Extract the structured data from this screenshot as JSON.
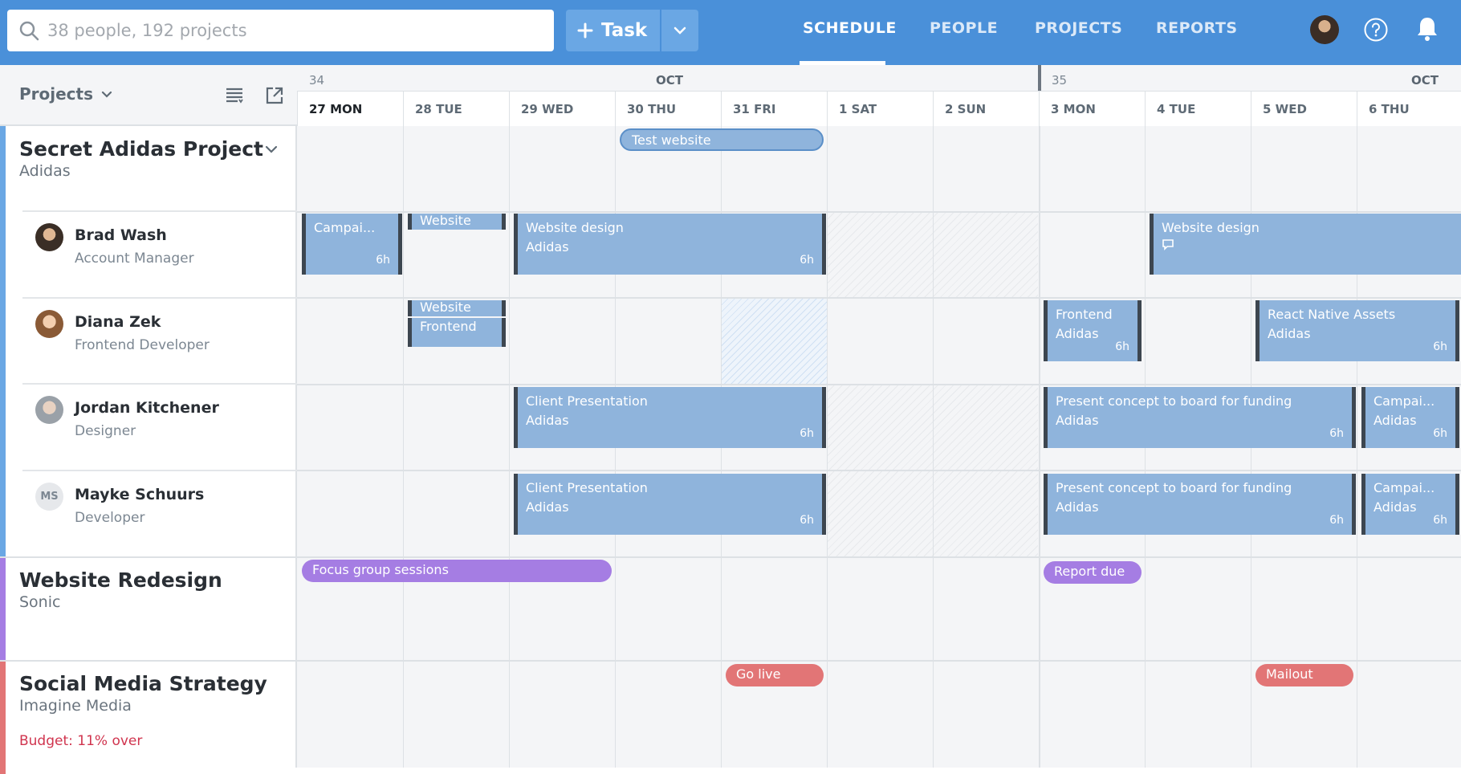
{
  "search": {
    "placeholder": "38 people, 192 projects"
  },
  "task_button": {
    "label": "Task"
  },
  "nav": {
    "schedule": "SCHEDULE",
    "people": "PEOPLE",
    "projects": "PROJECTS",
    "reports": "REPORTS"
  },
  "sidebar": {
    "projects_label": "Projects"
  },
  "calendar": {
    "week1": "34",
    "week2": "35",
    "month1": "OCT",
    "month2": "OCT",
    "days": [
      "27 MON",
      "28 TUE",
      "29 WED",
      "30 THU",
      "31 FRI",
      "1 SAT",
      "2 SUN",
      "3 MON",
      "4 TUE",
      "5 WED",
      "6 THU"
    ]
  },
  "projects": [
    {
      "name": "Secret Adidas Project",
      "client": "Adidas",
      "color": "#6aa7e4"
    },
    {
      "name": "Website Redesign",
      "client": "Sonic",
      "color": "#a57de3"
    },
    {
      "name": "Social Media Strategy",
      "client": "Imagine Media",
      "color": "#e27576",
      "budget": "Budget: 11% over"
    }
  ],
  "people": [
    {
      "name": "Brad Wash",
      "role": "Account Manager"
    },
    {
      "name": "Diana Zek",
      "role": "Frontend Developer"
    },
    {
      "name": "Jordan Kitchener",
      "role": "Designer"
    },
    {
      "name": "Mayke Schuurs",
      "role": "Developer",
      "initials": "MS"
    }
  ],
  "events": {
    "test_website": "Test website",
    "focus_group": "Focus group sessions",
    "report_due": "Report due",
    "go_live": "Go live",
    "mailout": "Mailout"
  },
  "tasks": {
    "brad_campaign": {
      "title": "Campai...",
      "hours": "6h"
    },
    "brad_website": {
      "title": "Website"
    },
    "brad_design": {
      "title": "Website design",
      "client": "Adidas",
      "hours": "6h"
    },
    "brad_design2": {
      "title": "Website design"
    },
    "diana_website": {
      "title": "Website"
    },
    "diana_frontend": {
      "title": "Frontend"
    },
    "diana_frontend2": {
      "title": "Frontend",
      "client": "Adidas",
      "hours": "6h"
    },
    "diana_rn": {
      "title": "React Native Assets",
      "client": "Adidas",
      "hours": "6h"
    },
    "jordan_client": {
      "title": "Client Presentation",
      "client": "Adidas",
      "hours": "6h"
    },
    "jordan_present": {
      "title": "Present concept to board for funding",
      "client": "Adidas",
      "hours": "6h"
    },
    "jordan_campaign": {
      "title": "Campai...",
      "client": "Adidas",
      "hours": "6h"
    },
    "mayke_client": {
      "title": "Client Presentation",
      "client": "Adidas",
      "hours": "6h"
    },
    "mayke_present": {
      "title": "Present concept to board for funding",
      "client": "Adidas",
      "hours": "6h"
    },
    "mayke_campaign": {
      "title": "Campai...",
      "client": "Adidas",
      "hours": "6h"
    }
  }
}
